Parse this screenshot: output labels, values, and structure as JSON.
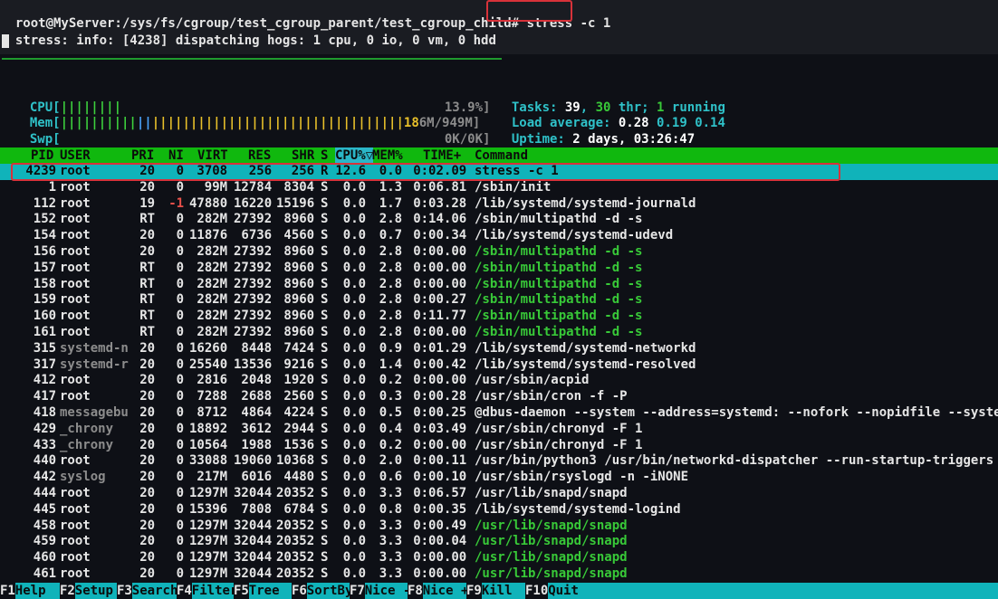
{
  "terminal": {
    "prompt": "root@MyServer:/sys/fs/cgroup/test_cgroup_parent/test_cgroup_child# ",
    "command": "stress -c 1",
    "output": "stress: info: [4238] dispatching hogs: 1 cpu, 0 io, 0 vm, 0 hdd"
  },
  "meters": {
    "cpu_label": "CPU[",
    "cpu_bar": "||||||||",
    "cpu_value": "13.9%]",
    "mem_label": "Mem[",
    "mem_bar_green": "||||||||||",
    "mem_bar_blue": "||",
    "mem_bar_yellow": "|||||||||||||||||||||||||||||||||",
    "mem_value_yellow": "18",
    "mem_value": "6M/949M]",
    "swp_label": "Swp[",
    "swp_value": "0K/0K]"
  },
  "summary": {
    "tasks_label": "Tasks: ",
    "tasks": "39",
    "thr": "30",
    "thr_label": " thr; ",
    "running": "1",
    "running_label": " running",
    "load_label": "Load average: ",
    "load1": "0.28",
    "load5": "0.19",
    "load15": "0.14",
    "uptime_label": "Uptime: ",
    "uptime": "2 days, 03:26:47"
  },
  "columns": [
    "PID",
    "USER",
    "PRI",
    "NI",
    "VIRT",
    "RES",
    "SHR",
    "S",
    "CPU%▽",
    "MEM%",
    "TIME+",
    "Command"
  ],
  "processes": [
    {
      "pid": "4239",
      "user": "root",
      "pri": "20",
      "ni": "0",
      "virt": "3708",
      "res": "256",
      "shr": "256",
      "s": "R",
      "cpu": "12.6",
      "mem": "0.0",
      "time": "0:02.09",
      "cmd": "stress -c 1",
      "selected": true
    },
    {
      "pid": "1",
      "user": "root",
      "pri": "20",
      "ni": "0",
      "virt": "99M",
      "res": "12784",
      "shr": "8304",
      "s": "S",
      "cpu": "0.0",
      "mem": "1.3",
      "time": "0:06.81",
      "cmd": "/sbin/init"
    },
    {
      "pid": "112",
      "user": "root",
      "pri": "19",
      "ni": "-1",
      "virt": "47880",
      "res": "16220",
      "shr": "15196",
      "s": "S",
      "cpu": "0.0",
      "mem": "1.7",
      "time": "0:03.28",
      "cmd": "/lib/systemd/systemd-journald"
    },
    {
      "pid": "152",
      "user": "root",
      "pri": "RT",
      "ni": "0",
      "virt": "282M",
      "res": "27392",
      "shr": "8960",
      "s": "S",
      "cpu": "0.0",
      "mem": "2.8",
      "time": "0:14.06",
      "cmd": "/sbin/multipathd -d -s"
    },
    {
      "pid": "154",
      "user": "root",
      "pri": "20",
      "ni": "0",
      "virt": "11876",
      "res": "6736",
      "shr": "4560",
      "s": "S",
      "cpu": "0.0",
      "mem": "0.7",
      "time": "0:00.34",
      "cmd": "/lib/systemd/systemd-udevd"
    },
    {
      "pid": "156",
      "user": "root",
      "pri": "20",
      "ni": "0",
      "virt": "282M",
      "res": "27392",
      "shr": "8960",
      "s": "S",
      "cpu": "0.0",
      "mem": "2.8",
      "time": "0:00.00",
      "cmd": "/sbin/multipathd -d -s",
      "thread": true
    },
    {
      "pid": "157",
      "user": "root",
      "pri": "RT",
      "ni": "0",
      "virt": "282M",
      "res": "27392",
      "shr": "8960",
      "s": "S",
      "cpu": "0.0",
      "mem": "2.8",
      "time": "0:00.00",
      "cmd": "/sbin/multipathd -d -s",
      "thread": true
    },
    {
      "pid": "158",
      "user": "root",
      "pri": "RT",
      "ni": "0",
      "virt": "282M",
      "res": "27392",
      "shr": "8960",
      "s": "S",
      "cpu": "0.0",
      "mem": "2.8",
      "time": "0:00.00",
      "cmd": "/sbin/multipathd -d -s",
      "thread": true
    },
    {
      "pid": "159",
      "user": "root",
      "pri": "RT",
      "ni": "0",
      "virt": "282M",
      "res": "27392",
      "shr": "8960",
      "s": "S",
      "cpu": "0.0",
      "mem": "2.8",
      "time": "0:00.27",
      "cmd": "/sbin/multipathd -d -s",
      "thread": true
    },
    {
      "pid": "160",
      "user": "root",
      "pri": "RT",
      "ni": "0",
      "virt": "282M",
      "res": "27392",
      "shr": "8960",
      "s": "S",
      "cpu": "0.0",
      "mem": "2.8",
      "time": "0:11.77",
      "cmd": "/sbin/multipathd -d -s",
      "thread": true
    },
    {
      "pid": "161",
      "user": "root",
      "pri": "RT",
      "ni": "0",
      "virt": "282M",
      "res": "27392",
      "shr": "8960",
      "s": "S",
      "cpu": "0.0",
      "mem": "2.8",
      "time": "0:00.00",
      "cmd": "/sbin/multipathd -d -s",
      "thread": true
    },
    {
      "pid": "315",
      "user": "systemd-n",
      "pri": "20",
      "ni": "0",
      "virt": "16260",
      "res": "8448",
      "shr": "7424",
      "s": "S",
      "cpu": "0.0",
      "mem": "0.9",
      "time": "0:01.29",
      "cmd": "/lib/systemd/systemd-networkd",
      "dimuser": true
    },
    {
      "pid": "317",
      "user": "systemd-r",
      "pri": "20",
      "ni": "0",
      "virt": "25540",
      "res": "13536",
      "shr": "9216",
      "s": "S",
      "cpu": "0.0",
      "mem": "1.4",
      "time": "0:00.42",
      "cmd": "/lib/systemd/systemd-resolved",
      "dimuser": true
    },
    {
      "pid": "412",
      "user": "root",
      "pri": "20",
      "ni": "0",
      "virt": "2816",
      "res": "2048",
      "shr": "1920",
      "s": "S",
      "cpu": "0.0",
      "mem": "0.2",
      "time": "0:00.00",
      "cmd": "/usr/sbin/acpid"
    },
    {
      "pid": "417",
      "user": "root",
      "pri": "20",
      "ni": "0",
      "virt": "7288",
      "res": "2688",
      "shr": "2560",
      "s": "S",
      "cpu": "0.0",
      "mem": "0.3",
      "time": "0:00.28",
      "cmd": "/usr/sbin/cron -f -P"
    },
    {
      "pid": "418",
      "user": "messagebu",
      "pri": "20",
      "ni": "0",
      "virt": "8712",
      "res": "4864",
      "shr": "4224",
      "s": "S",
      "cpu": "0.0",
      "mem": "0.5",
      "time": "0:00.25",
      "cmd": "@dbus-daemon --system --address=systemd: --nofork --nopidfile --systemd-",
      "dimuser": true
    },
    {
      "pid": "429",
      "user": "_chrony",
      "pri": "20",
      "ni": "0",
      "virt": "18892",
      "res": "3612",
      "shr": "2944",
      "s": "S",
      "cpu": "0.0",
      "mem": "0.4",
      "time": "0:03.49",
      "cmd": "/usr/sbin/chronyd -F 1",
      "dimuser": true
    },
    {
      "pid": "433",
      "user": "_chrony",
      "pri": "20",
      "ni": "0",
      "virt": "10564",
      "res": "1988",
      "shr": "1536",
      "s": "S",
      "cpu": "0.0",
      "mem": "0.2",
      "time": "0:00.00",
      "cmd": "/usr/sbin/chronyd -F 1",
      "dimuser": true
    },
    {
      "pid": "440",
      "user": "root",
      "pri": "20",
      "ni": "0",
      "virt": "33088",
      "res": "19060",
      "shr": "10368",
      "s": "S",
      "cpu": "0.0",
      "mem": "2.0",
      "time": "0:00.11",
      "cmd": "/usr/bin/python3 /usr/bin/networkd-dispatcher --run-startup-triggers"
    },
    {
      "pid": "442",
      "user": "syslog",
      "pri": "20",
      "ni": "0",
      "virt": "217M",
      "res": "6016",
      "shr": "4480",
      "s": "S",
      "cpu": "0.0",
      "mem": "0.6",
      "time": "0:00.10",
      "cmd": "/usr/sbin/rsyslogd -n -iNONE",
      "dimuser": true
    },
    {
      "pid": "444",
      "user": "root",
      "pri": "20",
      "ni": "0",
      "virt": "1297M",
      "res": "32044",
      "shr": "20352",
      "s": "S",
      "cpu": "0.0",
      "mem": "3.3",
      "time": "0:06.57",
      "cmd": "/usr/lib/snapd/snapd"
    },
    {
      "pid": "445",
      "user": "root",
      "pri": "20",
      "ni": "0",
      "virt": "15396",
      "res": "7808",
      "shr": "6784",
      "s": "S",
      "cpu": "0.0",
      "mem": "0.8",
      "time": "0:00.35",
      "cmd": "/lib/systemd/systemd-logind"
    },
    {
      "pid": "458",
      "user": "root",
      "pri": "20",
      "ni": "0",
      "virt": "1297M",
      "res": "32044",
      "shr": "20352",
      "s": "S",
      "cpu": "0.0",
      "mem": "3.3",
      "time": "0:00.49",
      "cmd": "/usr/lib/snapd/snapd",
      "thread": true
    },
    {
      "pid": "459",
      "user": "root",
      "pri": "20",
      "ni": "0",
      "virt": "1297M",
      "res": "32044",
      "shr": "20352",
      "s": "S",
      "cpu": "0.0",
      "mem": "3.3",
      "time": "0:00.04",
      "cmd": "/usr/lib/snapd/snapd",
      "thread": true
    },
    {
      "pid": "460",
      "user": "root",
      "pri": "20",
      "ni": "0",
      "virt": "1297M",
      "res": "32044",
      "shr": "20352",
      "s": "S",
      "cpu": "0.0",
      "mem": "3.3",
      "time": "0:00.00",
      "cmd": "/usr/lib/snapd/snapd",
      "thread": true
    },
    {
      "pid": "461",
      "user": "root",
      "pri": "20",
      "ni": "0",
      "virt": "1297M",
      "res": "32044",
      "shr": "20352",
      "s": "S",
      "cpu": "0.0",
      "mem": "3.3",
      "time": "0:00.00",
      "cmd": "/usr/lib/snapd/snapd",
      "thread": true
    }
  ],
  "footer": [
    {
      "key": "F1",
      "label": "Help"
    },
    {
      "key": "F2",
      "label": "Setup"
    },
    {
      "key": "F3",
      "label": "Search"
    },
    {
      "key": "F4",
      "label": "Filter"
    },
    {
      "key": "F5",
      "label": "Tree"
    },
    {
      "key": "F6",
      "label": "SortBy"
    },
    {
      "key": "F7",
      "label": "Nice -"
    },
    {
      "key": "F8",
      "label": "Nice +"
    },
    {
      "key": "F9",
      "label": "Kill"
    },
    {
      "key": "F10",
      "label": "Quit"
    }
  ],
  "colors": {
    "header_bg": "#10b80e",
    "selected_bg": "#10b3ba",
    "thread_fg": "#38c938",
    "highlight_box": "#d8323a"
  }
}
